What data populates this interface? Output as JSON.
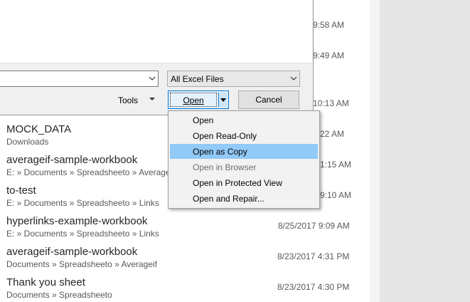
{
  "recent_files": [
    {
      "name": "MOCK_DATA",
      "path": "Downloads",
      "date": "22 AM"
    },
    {
      "name": "averageif-sample-workbook",
      "path": "E: » Documents » Spreadsheeto » Averageif",
      "date": "1:15 AM"
    },
    {
      "name": "to-test",
      "path": "E: » Documents » Spreadsheeto » Links",
      "date": "9:10 AM"
    },
    {
      "name": "hyperlinks-example-workbook",
      "path": "E: » Documents » Spreadsheeto » Links",
      "date": "8/25/2017 9:09 AM"
    },
    {
      "name": "averageif-sample-workbook",
      "path": "Documents » Spreadsheeto » Averageif",
      "date": "8/23/2017 4:31 PM"
    },
    {
      "name": "Thank you sheet",
      "path": "Documents » Spreadsheeto",
      "date": "8/23/2017 4:30 PM"
    }
  ],
  "partial_times": [
    "9:58 AM",
    "9:49 AM",
    "10:13 AM"
  ],
  "dialog": {
    "filename_value": "",
    "file_type": "All Excel Files",
    "tools_label": "Tools",
    "open_label": "Open",
    "cancel_label": "Cancel"
  },
  "open_menu": {
    "items": [
      "Open",
      "Open Read-Only",
      "Open as Copy",
      "Open in Browser",
      "Open in Protected View",
      "Open and Repair..."
    ],
    "selected": "Open as Copy",
    "disabled": "Open in Browser"
  },
  "colors": {
    "menu_highlight": "#91c9f7",
    "primary_button_border": "#0078d7",
    "menu_background": "#f2f2f2"
  }
}
